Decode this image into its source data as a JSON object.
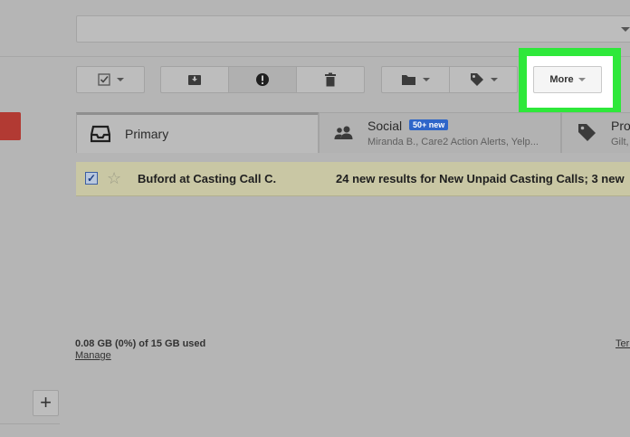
{
  "toolbar": {
    "more_label": "More"
  },
  "tabs": {
    "primary": {
      "title": "Primary"
    },
    "social": {
      "title": "Social",
      "badge": "50+ new",
      "subtitle": "Miranda B., Care2 Action Alerts, Yelp..."
    },
    "promotions": {
      "title": "Pro",
      "subtitle": "Gilt,"
    }
  },
  "email": {
    "sender": "Buford at Casting Call C.",
    "subject": "24 new results for New Unpaid Casting Calls; 3 new"
  },
  "footer": {
    "storage": "0.08 GB (0%) of 15 GB used",
    "manage_link": "Manage",
    "terms_link": "Terms"
  },
  "sidebar": {
    "add_label": "+"
  },
  "colors": {
    "highlight": "#2ee83a",
    "compose": "#b23a33",
    "selected_row": "#c9c7a4",
    "badge": "#2f66c9"
  }
}
